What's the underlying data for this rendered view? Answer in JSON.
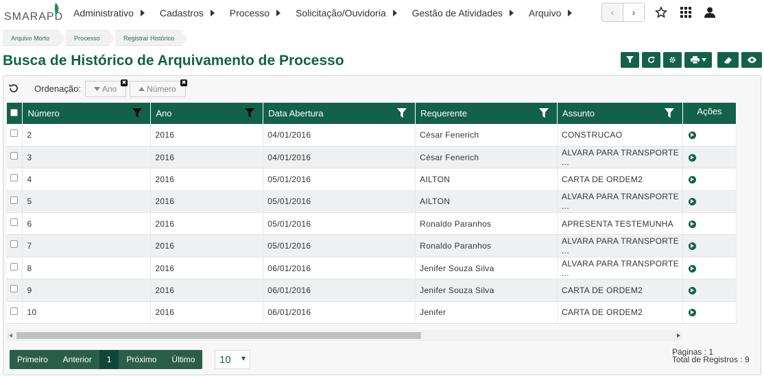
{
  "app": {
    "logo_text": "SMARAPD"
  },
  "menu": [
    {
      "label": "Administrativo"
    },
    {
      "label": "Cadastros"
    },
    {
      "label": "Processo"
    },
    {
      "label": "Solicitação/Ouvidoria"
    },
    {
      "label": "Gestão de Atividades"
    },
    {
      "label": "Arquivo"
    }
  ],
  "nav": {
    "prev": "‹",
    "next": "›"
  },
  "breadcrumb": [
    "Arquivo Morto",
    "Processo",
    "Registrar Histórico"
  ],
  "page": {
    "title": "Busca de Histórico de Arquivamento de Processo"
  },
  "sort": {
    "label": "Ordenação:",
    "items": [
      {
        "label": "Ano",
        "direction": "desc"
      },
      {
        "label": "Número",
        "direction": "asc"
      }
    ]
  },
  "table": {
    "columns": [
      "Número",
      "Ano",
      "Data Abertura",
      "Requerente",
      "Assunto",
      "Ações"
    ],
    "rows": [
      {
        "numero": "2",
        "ano": "2016",
        "data": "04/01/2016",
        "requerente": "César Fenerich",
        "assunto": "CONSTRUCAO"
      },
      {
        "numero": "3",
        "ano": "2016",
        "data": "04/01/2016",
        "requerente": "César Fenerich",
        "assunto": "ALVARA PARA TRANSPORTE ..."
      },
      {
        "numero": "4",
        "ano": "2016",
        "data": "05/01/2016",
        "requerente": "AILTON",
        "assunto": "CARTA DE ORDEM2"
      },
      {
        "numero": "5",
        "ano": "2016",
        "data": "05/01/2016",
        "requerente": "AILTON",
        "assunto": "ALVARA PARA TRANSPORTE ..."
      },
      {
        "numero": "6",
        "ano": "2016",
        "data": "05/01/2016",
        "requerente": "Ronaldo Paranhos",
        "assunto": "APRESENTA TESTEMUNHA"
      },
      {
        "numero": "7",
        "ano": "2016",
        "data": "05/01/2016",
        "requerente": "Ronaldo Paranhos",
        "assunto": "ALVARA PARA TRANSPORTE ..."
      },
      {
        "numero": "8",
        "ano": "2016",
        "data": "06/01/2016",
        "requerente": "Jenifer Souza Silva",
        "assunto": "ALVARA PARA TRANSPORTE ..."
      },
      {
        "numero": "9",
        "ano": "2016",
        "data": "06/01/2016",
        "requerente": "Jenifer Souza Silva",
        "assunto": "CARTA DE ORDEM2"
      },
      {
        "numero": "10",
        "ano": "2016",
        "data": "06/01/2016",
        "requerente": "Jenifer",
        "assunto": "CARTA DE ORDEM2"
      }
    ]
  },
  "pagination": {
    "first": "Primeiro",
    "prev": "Anterior",
    "current": "1",
    "next": "Próximo",
    "last": "Último",
    "page_size": "10",
    "pages_text": "Páginas : 1",
    "total_text": "Total de Registros : 9"
  },
  "colors": {
    "primary": "#136149",
    "pager": "#2a5e4a"
  }
}
